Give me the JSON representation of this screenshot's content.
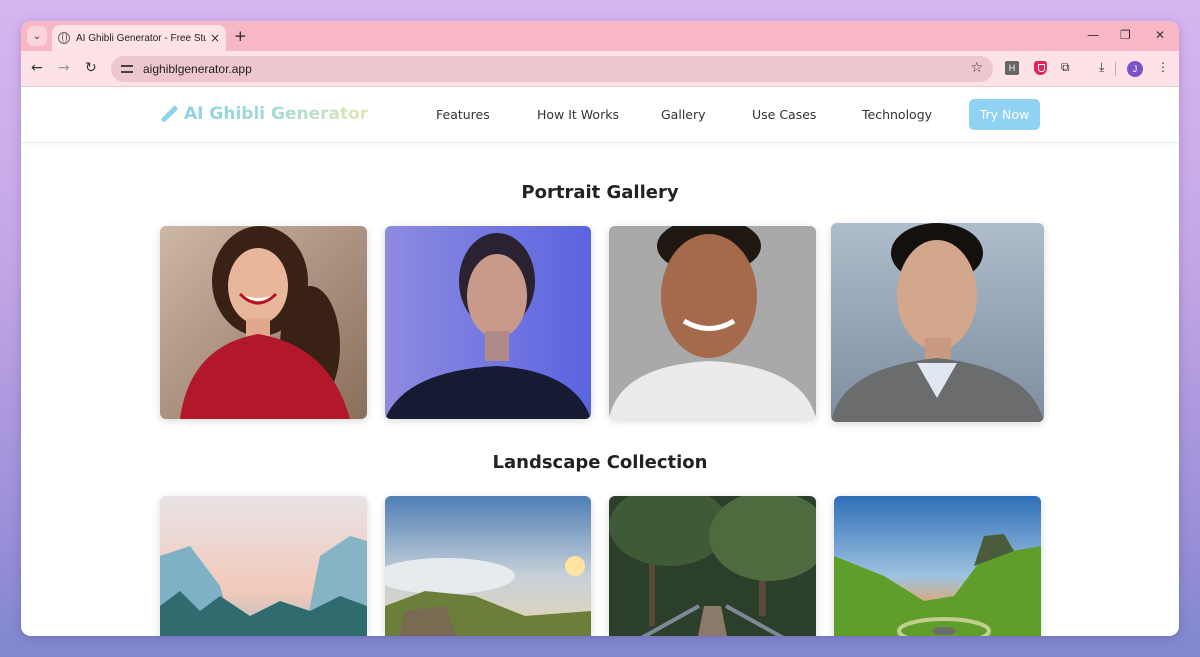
{
  "browser": {
    "tab_title": "AI Ghibli Generator - Free Studio Ghibli Style AI Art",
    "tab_close": "×",
    "new_tab": "+",
    "tab_search": "⌄",
    "url": "aighiblgenerator.app",
    "nav": {
      "back": "←",
      "forward": "→",
      "reload": "↻"
    },
    "star": "☆",
    "extensions": {
      "h_label": "H",
      "puzzle": "⧉",
      "download": "⤓",
      "menu": "⋮"
    },
    "profile_initial": "J",
    "window": {
      "minimize": "—",
      "restore": "❐",
      "close": "✕"
    }
  },
  "site": {
    "brand": "AI Ghibli Generator",
    "nav_links": [
      "Features",
      "How It Works",
      "Gallery",
      "Use Cases",
      "Technology"
    ],
    "cta": "Try Now"
  },
  "gallery": {
    "portrait_title": "Portrait Gallery",
    "landscape_title": "Landscape Collection"
  },
  "colors": {
    "tabstrip": "#f7b7c4",
    "toolbar": "#fde2e7",
    "cta": "#8fd2f2",
    "brand_gradient": [
      "#8fcfe8",
      "#e4e8b0"
    ]
  }
}
